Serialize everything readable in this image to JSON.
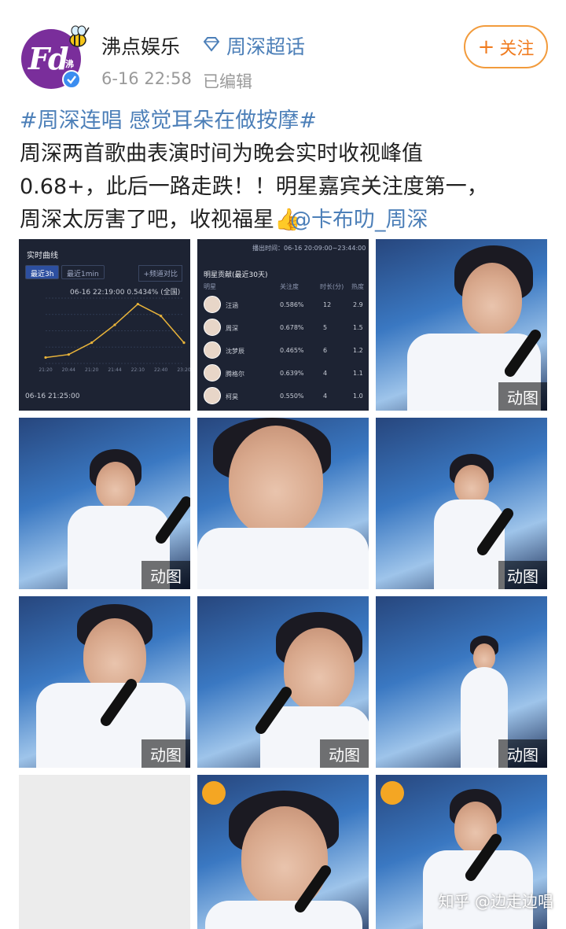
{
  "author": {
    "name": "沸点娱乐",
    "avatar_text": "Fd",
    "avatar_sub": "沸",
    "avatar_icon": "fd-logo-icon",
    "verified_icon": "verified-check-icon"
  },
  "supertopic": {
    "icon": "supertopic-diamond-icon",
    "label": "周深超话"
  },
  "meta": {
    "time": "6-16 22:58",
    "edited": "已编辑"
  },
  "follow": {
    "plus": "+",
    "label": "关注"
  },
  "post": {
    "hashtag": "#周深连唱 感觉耳朵在做按摩#",
    "line1": "周深两首歌曲表演时间为晚会实时收视峰值",
    "line2": "0.68+，此后一路走跌！！明星嘉宾关注度第一，",
    "line3_text": "周深太厉害了吧，收视福星",
    "thumb_emoji": "👍",
    "mention": "@卡布叻_周深"
  },
  "media": {
    "gif_label": "动图",
    "watermark": "知乎 @边走边唱"
  },
  "rating_chart": {
    "title": "实时曲线",
    "tab_active": "最近3h",
    "tab_inactive": "最近1min",
    "compare": "+频道对比",
    "readout_time": "06-16 22:19:00",
    "readout_value": "0.5434% (全国)",
    "footer_time": "06-16 21:25:00"
  },
  "chart_data": {
    "type": "line",
    "title": "实时曲线",
    "xlabel": "",
    "ylabel": "",
    "x": [
      "21:20",
      "20:44",
      "21:20",
      "21:44",
      "22:10",
      "22:40",
      "23:20"
    ],
    "series": [
      {
        "name": "",
        "values": [
          0.5,
          0.51,
          0.55,
          0.61,
          0.68,
          0.64,
          0.55
        ]
      }
    ],
    "ylim": [
      0.48,
      0.7
    ],
    "grid": true
  },
  "ranking": {
    "range": "播出时间：06-16 20:09:00~23:44:00",
    "title": "明星贡献(最近30天)",
    "headers": [
      "明星",
      "关注度",
      "时长(分)",
      "热度"
    ],
    "rows": [
      {
        "name": "汪涵",
        "share": "0.586%",
        "minutes": "12",
        "heat": "2.9"
      },
      {
        "name": "周深",
        "share": "0.678%",
        "minutes": "5",
        "heat": "1.5"
      },
      {
        "name": "沈梦辰",
        "share": "0.465%",
        "minutes": "6",
        "heat": "1.2"
      },
      {
        "name": "腾格尔",
        "share": "0.639%",
        "minutes": "4",
        "heat": "1.1"
      },
      {
        "name": "柯昊",
        "share": "0.550%",
        "minutes": "4",
        "heat": "1.0"
      }
    ]
  }
}
